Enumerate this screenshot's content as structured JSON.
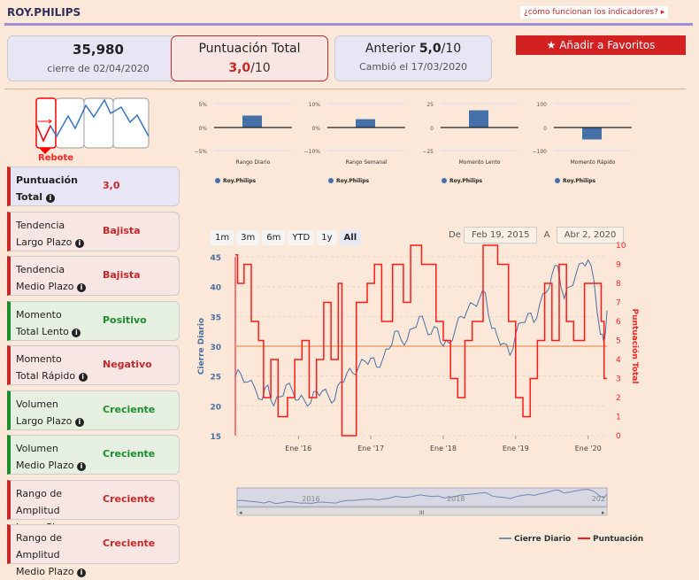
{
  "header": {
    "title": "ROY.PHILIPS",
    "help_link": "¿cómo funcionan los indicadores? ▸"
  },
  "summary": {
    "close_value": "35,980",
    "close_label": "cierre de 02/04/2020",
    "score_label": "Puntuación Total",
    "score_value": "3,0",
    "score_max": "/10",
    "prev_label": "Anterior",
    "prev_value": "5,0",
    "prev_max": "/10",
    "changed_label": "Cambió el 17/03/2020",
    "fav_button": "Añadir a Favoritos"
  },
  "pattern": {
    "label": "Rebote"
  },
  "indicators": [
    {
      "label1": "Puntuación",
      "label2": "Total",
      "value": "3,0",
      "state": "total"
    },
    {
      "label1": "Tendencia",
      "label2": "Largo Plazo",
      "value": "Bajista",
      "state": "red"
    },
    {
      "label1": "Tendencia",
      "label2": "Medio Plazo",
      "value": "Bajista",
      "state": "red"
    },
    {
      "label1": "Momento",
      "label2": "Total Lento",
      "value": "Positivo",
      "state": "grn"
    },
    {
      "label1": "Momento",
      "label2": "Total Rápido",
      "value": "Negativo",
      "state": "red"
    },
    {
      "label1": "Volumen",
      "label2": "Largo Plazo",
      "value": "Creciente",
      "state": "grn"
    },
    {
      "label1": "Volumen",
      "label2": "Medio Plazo",
      "value": "Creciente",
      "state": "grn"
    },
    {
      "label1": "Rango de Amplitud",
      "label2": "Largo Plazo",
      "value": "Creciente",
      "state": "red"
    },
    {
      "label1": "Rango de Amplitud",
      "label2": "Medio Plazo",
      "value": "Creciente",
      "state": "red"
    }
  ],
  "chart_data": [
    {
      "type": "bar",
      "title": "Rango Diario",
      "ticks": [
        "5%",
        "0%",
        "−5%"
      ],
      "ylim": [
        -5,
        5
      ],
      "values": [
        2.5
      ],
      "legend": "Roy.Philips"
    },
    {
      "type": "bar",
      "title": "Rango Semanal",
      "ticks": [
        "10%",
        "0%",
        "−10%"
      ],
      "ylim": [
        -10,
        10
      ],
      "values": [
        3.5
      ],
      "legend": "Roy.Philips"
    },
    {
      "type": "bar",
      "title": "Momento Lento",
      "ticks": [
        "25",
        "0",
        "−25"
      ],
      "ylim": [
        -25,
        25
      ],
      "values": [
        18
      ],
      "legend": "Roy.Philips"
    },
    {
      "type": "bar",
      "title": "Momento Rápido",
      "ticks": [
        "100",
        "0",
        "−100"
      ],
      "ylim": [
        -100,
        100
      ],
      "values": [
        -50
      ],
      "legend": "Roy.Philips"
    },
    {
      "type": "line",
      "range_buttons": [
        "1m",
        "3m",
        "6m",
        "YTD",
        "1y",
        "All"
      ],
      "from_label": "De",
      "from": "Feb 19, 2015",
      "to_label": "A",
      "to": "Abr 2, 2020",
      "ylabel": "Cierre Diario",
      "y2label": "Puntuación Total",
      "ylim": [
        15,
        45
      ],
      "y2lim": [
        0,
        10
      ],
      "yticks": [
        "45",
        "40",
        "35",
        "30",
        "25",
        "20",
        "15"
      ],
      "y2ticks": [
        "10",
        "9",
        "8",
        "7",
        "6",
        "5",
        "4",
        "3",
        "2",
        "1",
        "0"
      ],
      "xticks": [
        "Ene '16",
        "Ene '17",
        "Ene '18",
        "Ene '19",
        "Ene '20"
      ],
      "xlim": [
        2015.13,
        2020.26
      ],
      "reference_line": 30,
      "nav_labels": [
        "2016",
        "2018",
        "202"
      ],
      "series": [
        {
          "name": "Cierre Diario",
          "color": "#4a6fa5",
          "x": [
            2015.13,
            2015.2,
            2015.3,
            2015.4,
            2015.5,
            2015.58,
            2015.66,
            2015.75,
            2015.83,
            2015.92,
            2016.0,
            2016.08,
            2016.17,
            2016.25,
            2016.33,
            2016.42,
            2016.5,
            2016.58,
            2016.67,
            2016.75,
            2016.83,
            2016.92,
            2017.0,
            2017.08,
            2017.17,
            2017.25,
            2017.33,
            2017.42,
            2017.5,
            2017.58,
            2017.67,
            2017.75,
            2017.83,
            2017.92,
            2018.0,
            2018.08,
            2018.17,
            2018.25,
            2018.33,
            2018.42,
            2018.5,
            2018.58,
            2018.67,
            2018.75,
            2018.83,
            2018.92,
            2019.0,
            2019.08,
            2019.17,
            2019.25,
            2019.33,
            2019.42,
            2019.5,
            2019.58,
            2019.67,
            2019.75,
            2019.83,
            2019.92,
            2020.0,
            2020.08,
            2020.17,
            2020.22,
            2020.26
          ],
          "values": [
            25,
            25.5,
            24,
            23,
            21,
            23.5,
            20,
            21.5,
            23.5,
            22.5,
            21,
            21,
            20.5,
            22.5,
            22.5,
            21.5,
            21,
            24,
            25.5,
            25.5,
            26.5,
            27.5,
            28,
            26.5,
            28,
            29.5,
            32.5,
            31,
            31,
            33,
            35,
            33.5,
            32,
            33,
            30,
            30.5,
            33,
            35,
            36,
            37,
            38,
            39,
            33,
            31.5,
            30.5,
            28.5,
            32,
            34,
            35.5,
            34,
            37,
            39,
            42,
            43.5,
            38,
            40,
            42,
            44,
            44.5,
            41,
            32,
            30.5,
            36
          ]
        },
        {
          "name": "Puntuación",
          "color": "#ff1a1a",
          "x": [
            2015.13,
            2015.16,
            2015.25,
            2015.35,
            2015.45,
            2015.52,
            2015.62,
            2015.72,
            2015.85,
            2015.95,
            2016.05,
            2016.15,
            2016.25,
            2016.35,
            2016.45,
            2016.55,
            2016.6,
            2016.8,
            2016.95,
            2017.05,
            2017.15,
            2017.3,
            2017.45,
            2017.55,
            2017.7,
            2017.9,
            2018.0,
            2018.1,
            2018.2,
            2018.3,
            2018.4,
            2018.55,
            2018.75,
            2018.9,
            2019.0,
            2019.1,
            2019.2,
            2019.3,
            2019.4,
            2019.5,
            2019.6,
            2019.7,
            2019.8,
            2019.95,
            2020.1,
            2020.18,
            2020.22
          ],
          "values": [
            9.5,
            8,
            9,
            6,
            5,
            2,
            4,
            1,
            2,
            4,
            5,
            2,
            4,
            7,
            4,
            8,
            0,
            7,
            8,
            9,
            6,
            9,
            7,
            10,
            9,
            6,
            5,
            3,
            2,
            5,
            6,
            10,
            9,
            6,
            2,
            1,
            3,
            5,
            8,
            5,
            9,
            6,
            5,
            8,
            8,
            6,
            3
          ]
        }
      ],
      "legend": [
        "Cierre Diario",
        "Puntuación"
      ]
    }
  ]
}
